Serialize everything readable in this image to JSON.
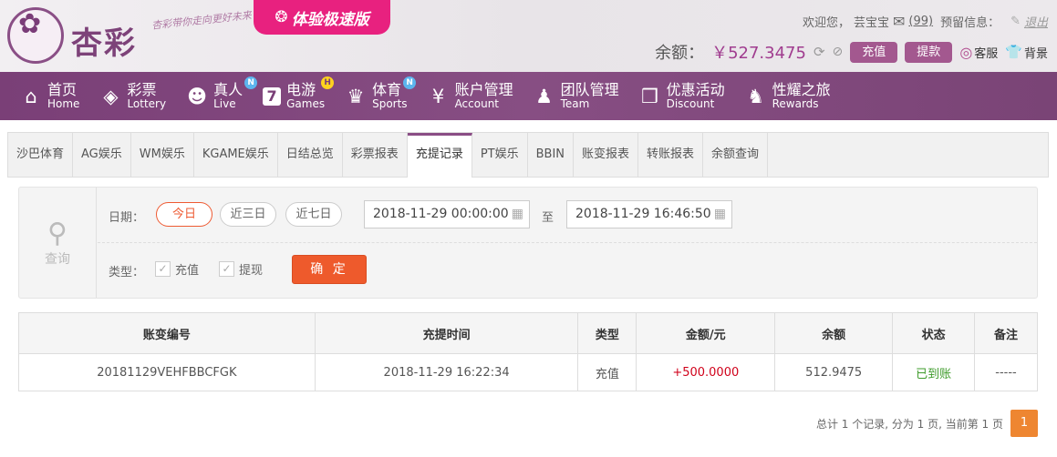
{
  "brand": {
    "name": "杏彩",
    "slogan": "杏彩带你走向更好未来",
    "badge": "体验极速版"
  },
  "user": {
    "welcome": "欢迎您，",
    "name": "芸宝宝",
    "msg_count": "(99)",
    "notice": "预留信息：",
    "logout": "退出",
    "balance_label": "余额：",
    "balance": "￥527.3475",
    "deposit": "充值",
    "withdraw": "提款",
    "service": "客服",
    "background": "背景"
  },
  "colors": {
    "accent": "#ee5a2c",
    "nav": "#7a3f77",
    "page_active": "#ee8631",
    "positive": "#d0021b",
    "ok": "#3f9c2c"
  },
  "nav": [
    {
      "zh": "首页",
      "en": "Home",
      "icon": "home-icon",
      "badge": ""
    },
    {
      "zh": "彩票",
      "en": "Lottery",
      "icon": "lottery-icon",
      "badge": ""
    },
    {
      "zh": "真人",
      "en": "Live",
      "icon": "live-icon",
      "badge": "N"
    },
    {
      "zh": "电游",
      "en": "Games",
      "icon": "games-icon",
      "badge": "H"
    },
    {
      "zh": "体育",
      "en": "Sports",
      "icon": "sports-icon",
      "badge": "N"
    },
    {
      "zh": "账户管理",
      "en": "Account",
      "icon": "account-icon",
      "badge": ""
    },
    {
      "zh": "团队管理",
      "en": "Team",
      "icon": "team-icon",
      "badge": ""
    },
    {
      "zh": "优惠活动",
      "en": "Discount",
      "icon": "gift-icon",
      "badge": ""
    },
    {
      "zh": "性耀之旅",
      "en": "Rewards",
      "icon": "rewards-icon",
      "badge": ""
    }
  ],
  "tabs": [
    "沙巴体育",
    "AG娱乐",
    "WM娱乐",
    "KGAME娱乐",
    "日结总览",
    "彩票报表",
    "充提记录",
    "PT娱乐",
    "BBIN",
    "账变报表",
    "转账报表",
    "余额查询"
  ],
  "active_tab": "充提记录",
  "filter": {
    "query": "查询",
    "date_label": "日期：",
    "quick": [
      "今日",
      "近三日",
      "近七日"
    ],
    "from": "2018-11-29 00:00:00",
    "to_label": "至",
    "to": "2018-11-29 16:46:50",
    "type_label": "类型：",
    "types": [
      "充值",
      "提现"
    ],
    "confirm": "确 定"
  },
  "table": {
    "headers": [
      "账变编号",
      "充提时间",
      "类型",
      "金额/元",
      "余额",
      "状态",
      "备注"
    ],
    "rows": [
      [
        "20181129VEHFBBCFGK",
        "2018-11-29 16:22:34",
        "充值",
        "+500.0000",
        "512.9475",
        "已到账",
        "-----"
      ]
    ]
  },
  "pager": {
    "summary": "总计 1 个记录, 分为 1 页, 当前第 1 页",
    "page": "1"
  }
}
